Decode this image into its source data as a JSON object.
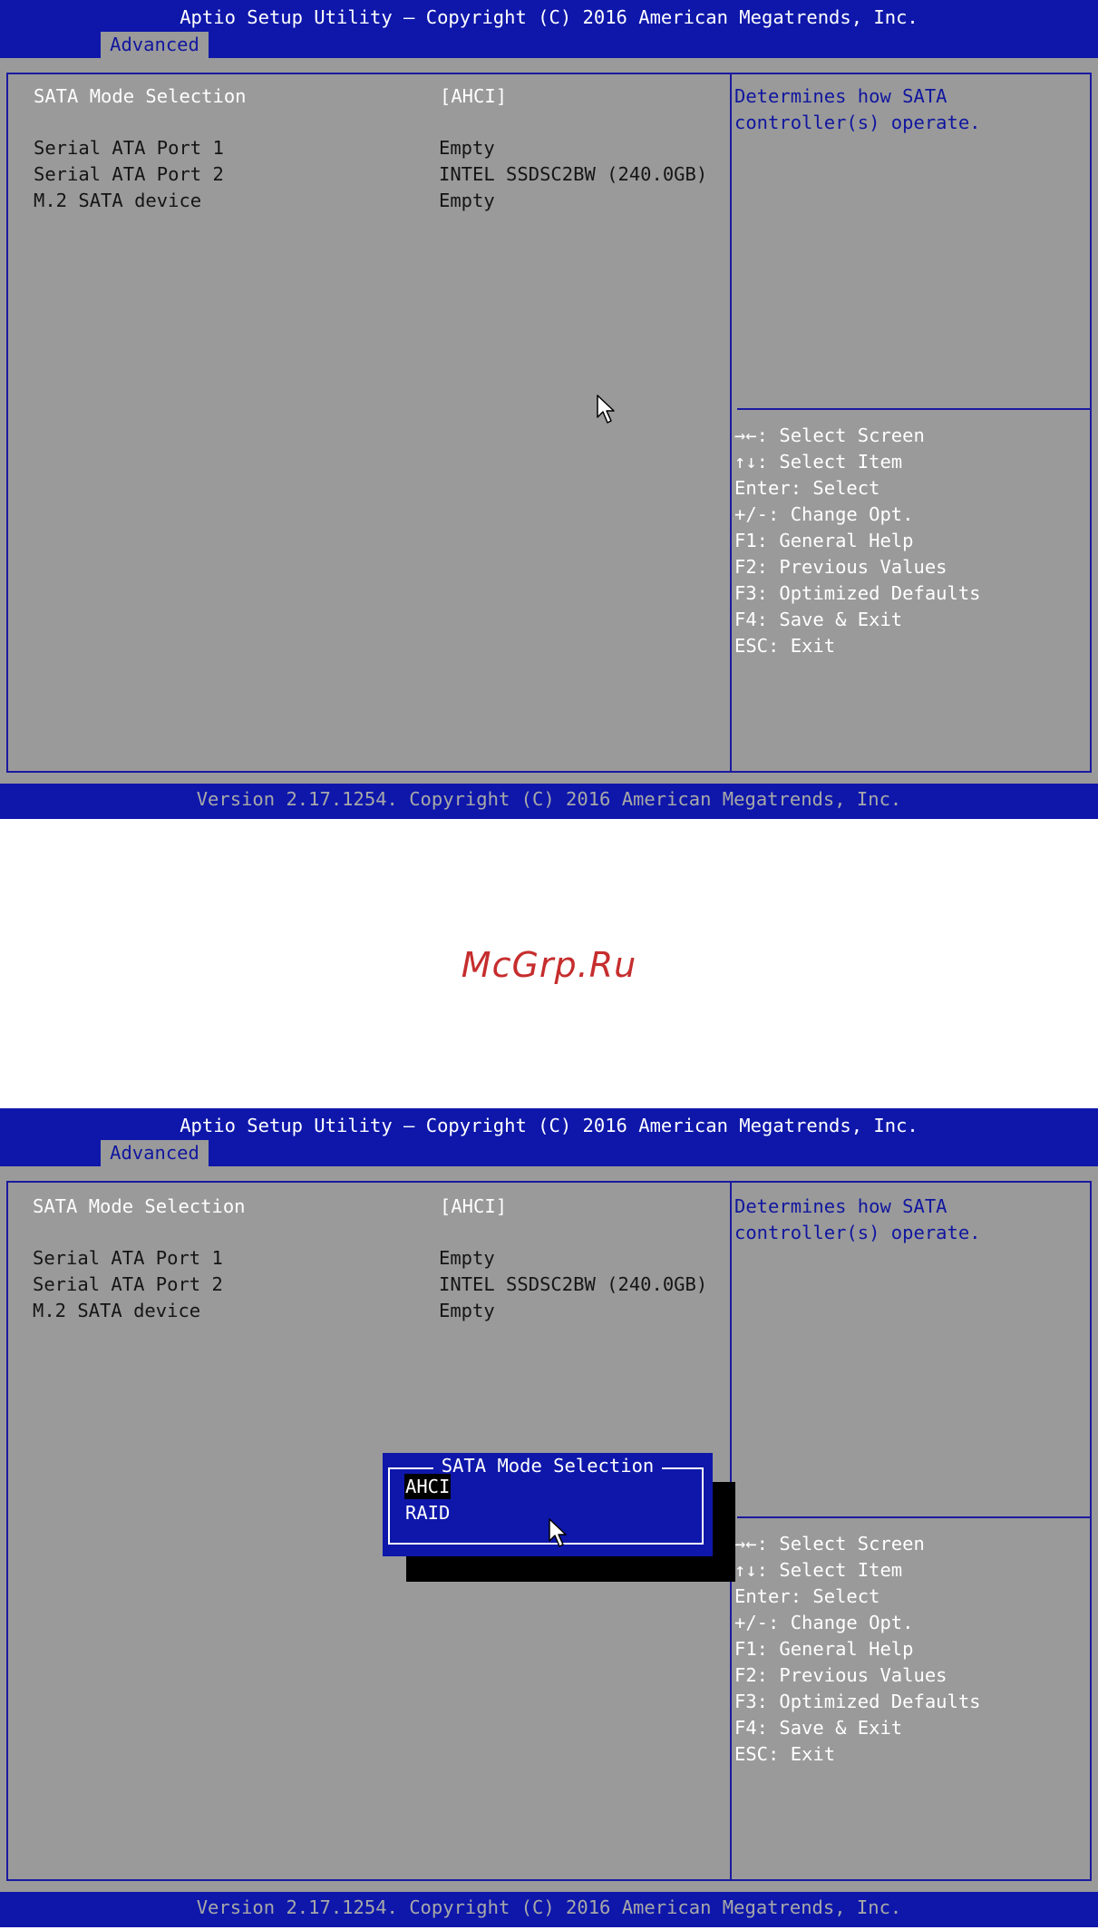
{
  "header": {
    "title": "Aptio Setup Utility – Copyright (C) 2016 American Megatrends, Inc.",
    "tab": "Advanced"
  },
  "footer": {
    "version": "Version 2.17.1254. Copyright (C) 2016 American Megatrends, Inc."
  },
  "settings": {
    "sata_mode": {
      "label": "SATA Mode Selection",
      "value": "[AHCI]"
    },
    "port1": {
      "label": "Serial ATA Port 1",
      "value": "Empty"
    },
    "port2": {
      "label": "Serial ATA Port 2",
      "value": "INTEL SSDSC2BW (240.0GB)"
    },
    "m2": {
      "label": "M.2 SATA device",
      "value": "Empty"
    }
  },
  "help": {
    "line1": "Determines how SATA",
    "line2": "controller(s) operate."
  },
  "keys": [
    "→←: Select Screen",
    "↑↓: Select Item",
    "Enter: Select",
    "+/-: Change Opt.",
    "F1: General Help",
    "F2: Previous Values",
    "F3: Optimized Defaults",
    "F4: Save & Exit",
    "ESC: Exit"
  ],
  "watermark": "McGrp.Ru",
  "popup": {
    "title": "SATA Mode Selection",
    "options": [
      "AHCI",
      "RAID"
    ],
    "selected": "AHCI"
  },
  "icons": {
    "pointer": "mouse-pointer-icon"
  },
  "colors": {
    "header_blue": "#0e17aa",
    "body_gray": "#9a9a9a",
    "text_white": "#ffffff",
    "watermark_red": "#c62d2d"
  }
}
